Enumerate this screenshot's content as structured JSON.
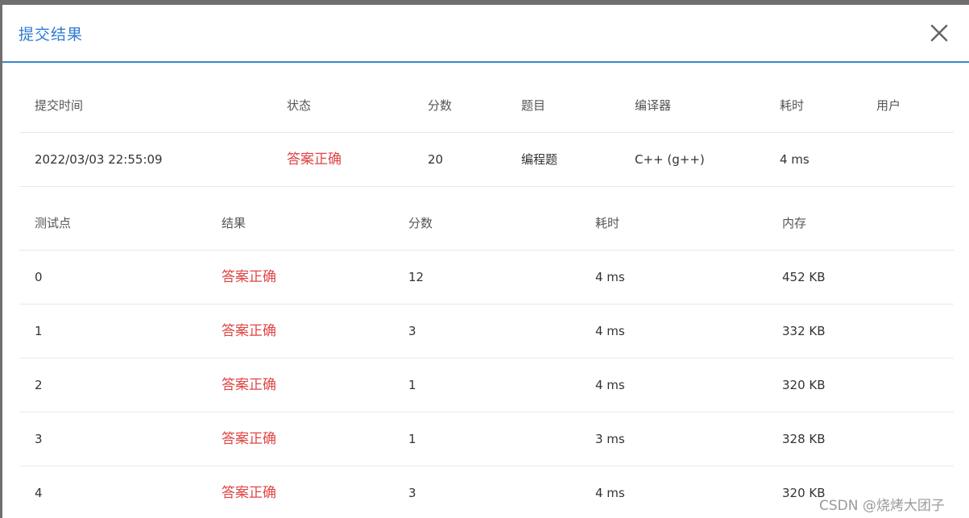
{
  "dialog": {
    "title": "提交结果"
  },
  "submission": {
    "headers": [
      "提交时间",
      "状态",
      "分数",
      "题目",
      "编译器",
      "耗时",
      "用户"
    ],
    "row": {
      "time": "2022/03/03 22:55:09",
      "status": "答案正确",
      "score": "20",
      "problem": "编程题",
      "compiler": "C++ (g++)",
      "duration": "4 ms",
      "user": ""
    }
  },
  "testcases": {
    "headers": [
      "测试点",
      "结果",
      "分数",
      "耗时",
      "内存"
    ],
    "rows": [
      {
        "id": "0",
        "result": "答案正确",
        "score": "12",
        "time": "4 ms",
        "memory": "452 KB"
      },
      {
        "id": "1",
        "result": "答案正确",
        "score": "3",
        "time": "4 ms",
        "memory": "332 KB"
      },
      {
        "id": "2",
        "result": "答案正确",
        "score": "1",
        "time": "4 ms",
        "memory": "320 KB"
      },
      {
        "id": "3",
        "result": "答案正确",
        "score": "1",
        "time": "3 ms",
        "memory": "328 KB"
      },
      {
        "id": "4",
        "result": "答案正确",
        "score": "3",
        "time": "4 ms",
        "memory": "320 KB"
      }
    ]
  },
  "watermark": {
    "text": "CSDN @烧烤大团子"
  },
  "colors": {
    "accent": "#2f7bd2",
    "success_text": "#e04545",
    "divider": "#e8e8e8"
  }
}
